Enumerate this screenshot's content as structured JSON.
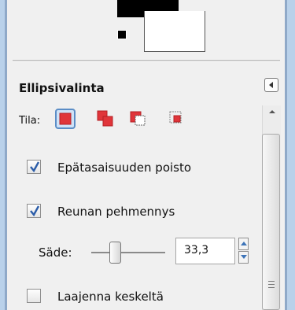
{
  "panel": {
    "title": "Ellipsivalinta",
    "mode_label": "Tila:",
    "mode_buttons": [
      "replace-mode",
      "add-mode",
      "subtract-mode",
      "intersect-mode"
    ],
    "selected_mode": "replace-mode"
  },
  "options": {
    "antialias": {
      "label": "Epätasaisuuden poisto",
      "checked": true
    },
    "feather": {
      "label": "Reunan pehmennys",
      "checked": true
    },
    "radius": {
      "label": "Säde:",
      "value": "33,3"
    },
    "expand_center": {
      "label": "Laajenna keskeltä",
      "checked": false
    }
  },
  "colors": {
    "foreground": "#000000",
    "background": "#ffffff",
    "accent": "#3d74b8",
    "mode_red": "#e0353a"
  }
}
